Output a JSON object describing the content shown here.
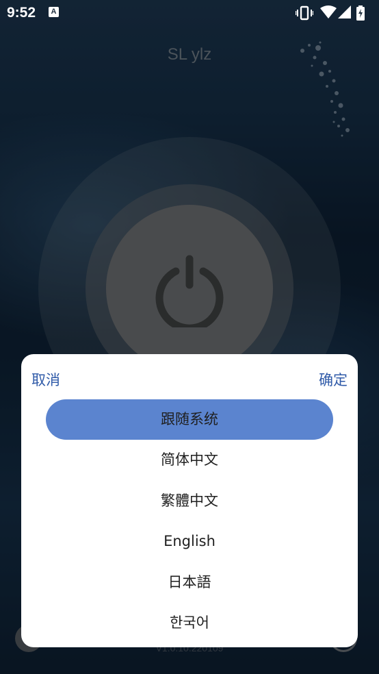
{
  "status_bar": {
    "time": "9:52",
    "app_icon_letter": "A",
    "icons": [
      "vibrate-icon",
      "wifi-icon",
      "signal-icon",
      "battery-charging-icon"
    ]
  },
  "app": {
    "title": "SL ylz",
    "version": "V1.0.10.220109"
  },
  "dialog": {
    "cancel_label": "取消",
    "confirm_label": "确定",
    "options": [
      {
        "label": "跟随系统",
        "selected": true
      },
      {
        "label": "简体中文",
        "selected": false
      },
      {
        "label": "繁體中文",
        "selected": false
      },
      {
        "label": "English",
        "selected": false
      },
      {
        "label": "日本語",
        "selected": false
      },
      {
        "label": "한국어",
        "selected": false
      }
    ]
  },
  "colors": {
    "accent": "#2f5aa8",
    "selected_bg": "#5b84cf"
  }
}
